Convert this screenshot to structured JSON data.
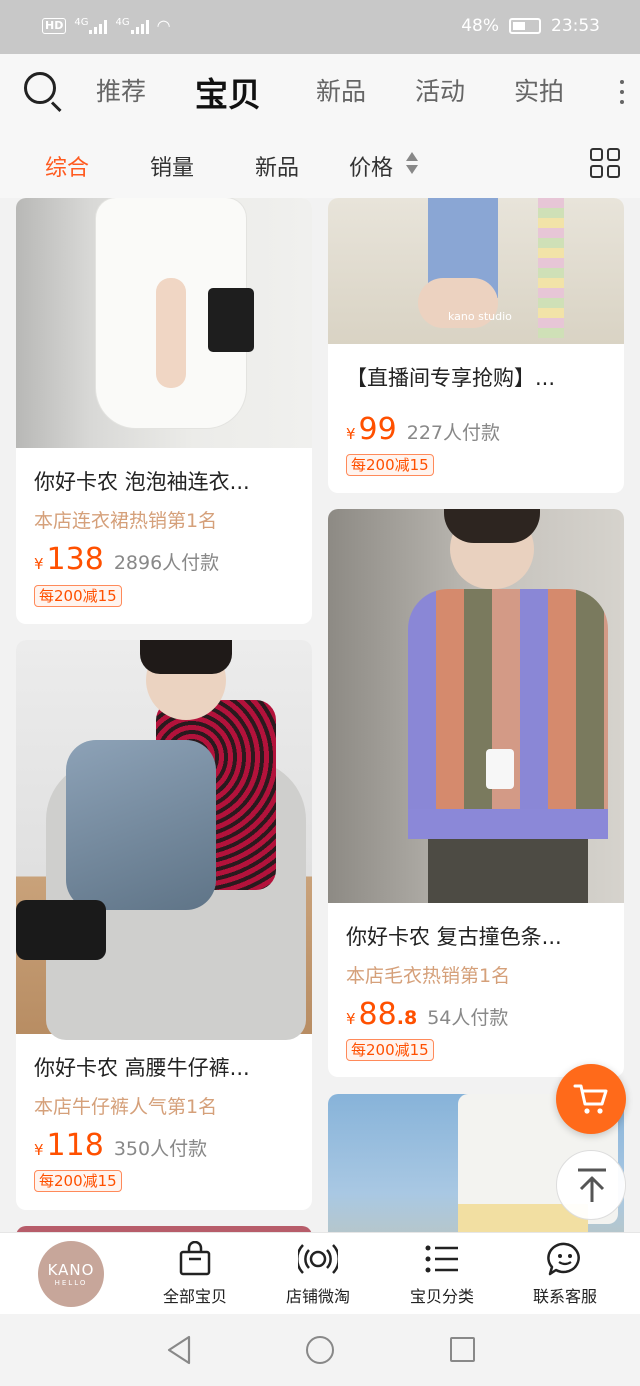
{
  "status_bar": {
    "hd": "HD",
    "network1": "4G",
    "network2": "4G",
    "battery": "48%",
    "time": "23:53"
  },
  "top_tabs": [
    "推荐",
    "宝贝",
    "新品",
    "活动",
    "实拍"
  ],
  "sort_bar": {
    "items": [
      "综合",
      "销量",
      "新品",
      "价格"
    ],
    "active_color": "#ff5a1f"
  },
  "products": [
    {
      "title": "你好卡农 泡泡袖连衣...",
      "rank": "本店连衣裙热销第1名",
      "currency": "¥",
      "price": "138",
      "price_decimal": "",
      "sold": "2896人付款",
      "coupon": "每200减15"
    },
    {
      "title": "【直播间专享抢购】...",
      "rank": "",
      "currency": "¥",
      "price": "99",
      "price_decimal": "",
      "sold": "227人付款",
      "coupon": "每200减15",
      "image_watermark": "kano studio"
    },
    {
      "title": "你好卡农 复古撞色条...",
      "rank": "本店毛衣热销第1名",
      "currency": "¥",
      "price": "88",
      "price_decimal": ".8",
      "sold": "54人付款",
      "coupon": "每200减15"
    },
    {
      "title": "你好卡农 高腰牛仔裤...",
      "rank": "本店牛仔裤人气第1名",
      "currency": "¥",
      "price": "118",
      "price_decimal": "",
      "sold": "350人付款",
      "coupon": "每200减15"
    }
  ],
  "store_nav": {
    "logo_line1": "KANO",
    "logo_line2": "HELLO",
    "items": [
      "全部宝贝",
      "店铺微淘",
      "宝贝分类",
      "联系客服"
    ]
  },
  "colors": {
    "price": "#ff5000",
    "rank": "#d5a07a",
    "cart_button": "#ff6a1a"
  },
  "icons": [
    "search-icon",
    "more-icon",
    "sort-arrows-icon",
    "grid-view-icon",
    "cart-icon",
    "back-to-top-icon",
    "bag-icon",
    "broadcast-icon",
    "list-icon",
    "chat-face-icon",
    "back-icon",
    "home-icon",
    "recents-icon"
  ]
}
